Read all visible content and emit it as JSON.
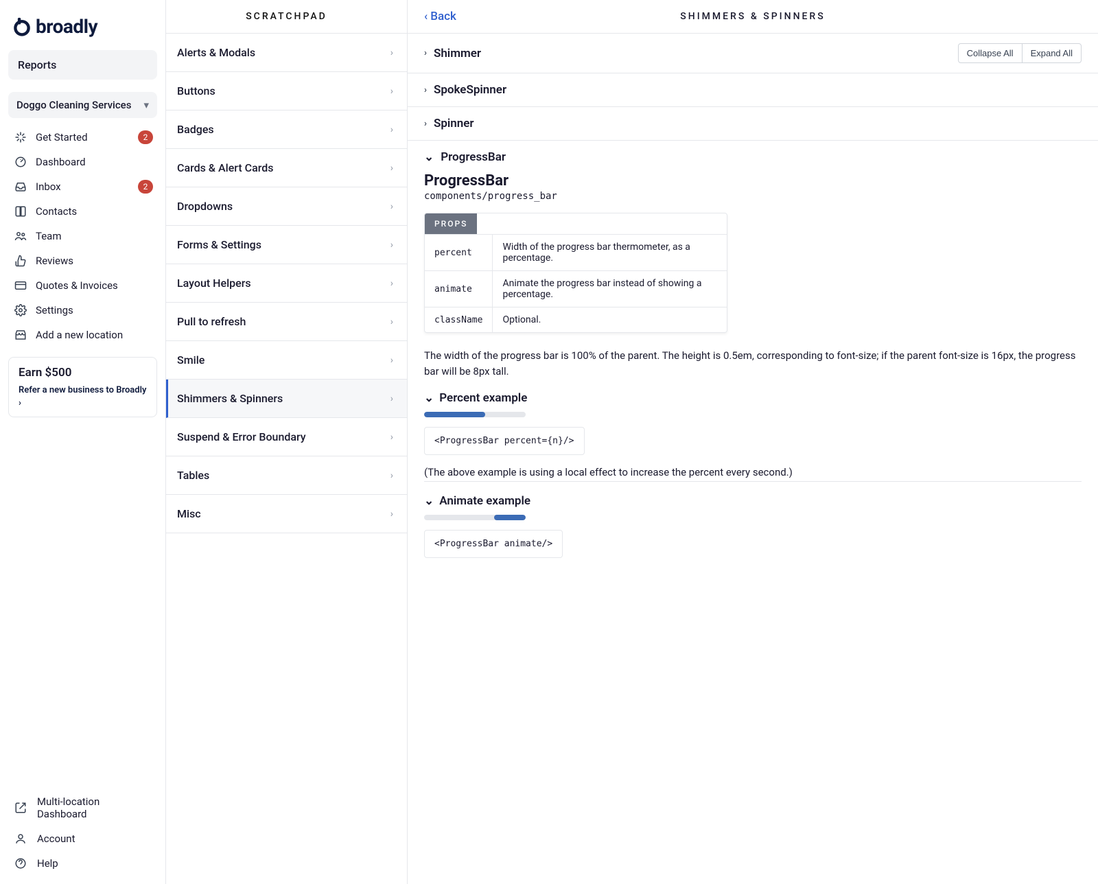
{
  "brand": "broadly",
  "sidebar": {
    "reports_label": "Reports",
    "org_name": "Doggo Cleaning Services",
    "nav": [
      {
        "label": "Get Started",
        "badge": "2"
      },
      {
        "label": "Dashboard"
      },
      {
        "label": "Inbox",
        "badge": "2"
      },
      {
        "label": "Contacts"
      },
      {
        "label": "Team"
      },
      {
        "label": "Reviews"
      },
      {
        "label": "Quotes & Invoices"
      },
      {
        "label": "Settings"
      },
      {
        "label": "Add a new location"
      }
    ],
    "earn": {
      "title": "Earn $500",
      "sub": "Refer a new business to Broadly",
      "chev": "›"
    },
    "bottom": [
      {
        "label": "Multi-location Dashboard"
      },
      {
        "label": "Account"
      },
      {
        "label": "Help"
      }
    ]
  },
  "col2": {
    "title": "SCRATCHPAD",
    "items": [
      "Alerts & Modals",
      "Buttons",
      "Badges",
      "Cards & Alert Cards",
      "Dropdowns",
      "Forms & Settings",
      "Layout Helpers",
      "Pull to refresh",
      "Smile",
      "Shimmers & Spinners",
      "Suspend & Error Boundary",
      "Tables",
      "Misc"
    ],
    "active_index": 9
  },
  "col3": {
    "back_label": "Back",
    "title": "SHIMMERS & SPINNERS",
    "collapse_label": "Collapse All",
    "expand_label": "Expand All",
    "sections": [
      "Shimmer",
      "SpokeSpinner",
      "Spinner",
      "ProgressBar"
    ],
    "progressbar": {
      "title": "ProgressBar",
      "path": "components/progress_bar",
      "props_label": "PROPS",
      "props": [
        {
          "name": "percent",
          "desc": "Width of the progress bar thermometer, as a percentage."
        },
        {
          "name": "animate",
          "desc": "Animate the progress bar instead of showing a percentage."
        },
        {
          "name": "className",
          "desc": "Optional."
        }
      ],
      "body": "The width of the progress bar is 100% of the parent. The height is 0.5em, corresponding to font-size; if the parent font-size is 16px, the progress bar will be 8px tall.",
      "percent_label": "Percent example",
      "percent_value": 60,
      "percent_code": "<ProgressBar percent={n}/>",
      "percent_note": "(The above example is using a local effect to increase the percent every second.)",
      "animate_label": "Animate example",
      "animate_code": "<ProgressBar animate/>"
    }
  }
}
